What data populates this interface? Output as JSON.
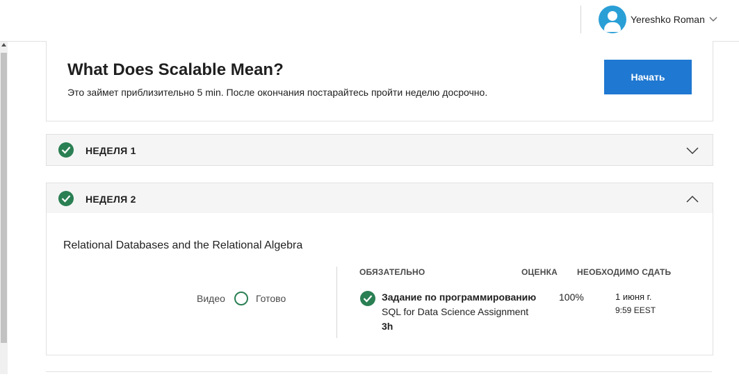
{
  "header": {
    "user_name": "Yereshko Roman",
    "avatar_color": "#2a9fd6"
  },
  "lesson_card": {
    "title": "What Does Scalable Mean?",
    "subtitle": "Это займет приблизительно 5 min. После окончания постарайтесь пройти неделю досрочно.",
    "start_button": "Начать",
    "accent_color": "#1f78d1"
  },
  "weeks": [
    {
      "label": "НЕДЕЛЯ 1",
      "completed": true,
      "expanded": false
    },
    {
      "label": "НЕДЕЛЯ 2",
      "completed": true,
      "expanded": true
    }
  ],
  "week2": {
    "lesson_title": "Relational Databases and the Relational Algebra",
    "video_label": "Видео",
    "ready_label": "Готово",
    "columns": {
      "required": "ОБЯЗАТЕЛЬНО",
      "grade": "ОЦЕНКА",
      "due": "НЕОБХОДИМО СДАТЬ"
    },
    "assignment": {
      "type": "Задание по программированию",
      "name": "SQL for Data Science Assignment",
      "duration": "3h",
      "grade": "100%",
      "due_date": "1 июня г.",
      "due_time": "9:59 EEST",
      "completed": true
    }
  },
  "colors": {
    "success": "#2a7f53"
  }
}
